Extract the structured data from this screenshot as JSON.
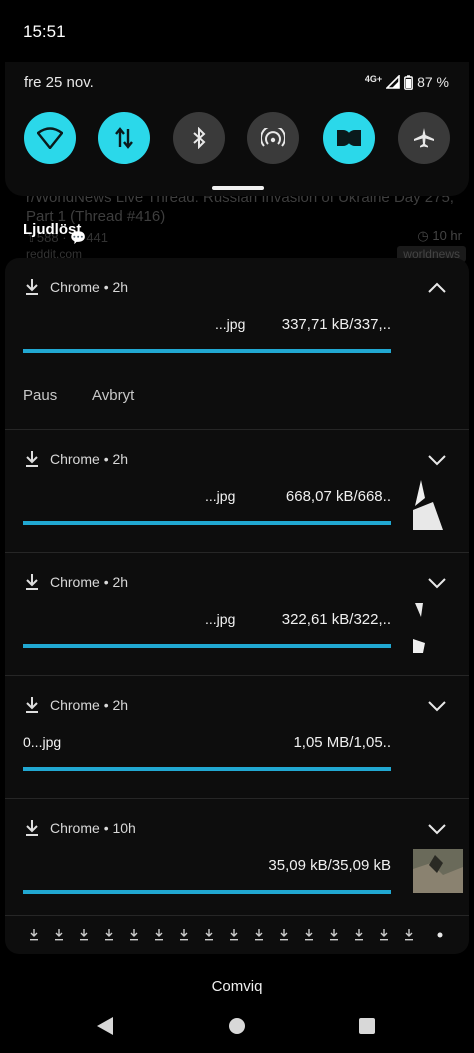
{
  "status_bar": {
    "time": "15:51"
  },
  "quick_settings": {
    "date": "fre 25 nov.",
    "network_type": "4G+",
    "battery": "87 %",
    "tiles": [
      {
        "name": "wifi",
        "on": true
      },
      {
        "name": "mobile-data",
        "on": true
      },
      {
        "name": "bluetooth",
        "on": false
      },
      {
        "name": "hotspot",
        "on": false
      },
      {
        "name": "dolby",
        "on": true
      },
      {
        "name": "airplane-mode",
        "on": false
      }
    ]
  },
  "background_notification": {
    "title": "r/WorldNews Live Thread: Russian Invasion of Ukraine Day 275, Part 1 (Thread #416)",
    "meta": "⇧588 · 💬441",
    "time": "10 hr",
    "source": "reddit.com",
    "chip": "worldnews"
  },
  "silent_section": {
    "label": "Ljudlöst"
  },
  "downloads": [
    {
      "app": "Chrome",
      "age": "2h",
      "filename": "...jpg",
      "size": "337,71 kB/337,..",
      "progress": 1.0,
      "expanded": true
    },
    {
      "app": "Chrome",
      "age": "2h",
      "filename": "...jpg",
      "size": "668,07 kB/668..",
      "progress": 1.0,
      "expanded": false
    },
    {
      "app": "Chrome",
      "age": "2h",
      "filename": "...jpg",
      "size": "322,61 kB/322,..",
      "progress": 1.0,
      "expanded": false
    },
    {
      "app": "Chrome",
      "age": "2h",
      "filename": "0...jpg",
      "size": "1,05 MB/1,05..",
      "progress": 1.0,
      "expanded": false
    },
    {
      "app": "Chrome",
      "age": "10h",
      "filename": "",
      "size": "35,09 kB/35,09 kB",
      "progress": 1.0,
      "expanded": false
    }
  ],
  "actions": {
    "pause": "Paus",
    "cancel": "Avbryt"
  },
  "separator": {
    "dot": "•"
  },
  "carrier": "Comviq",
  "colors": {
    "accent": "#2bd8ea",
    "progress": "#21a8d2",
    "tile_off": "#3a3a3a"
  }
}
